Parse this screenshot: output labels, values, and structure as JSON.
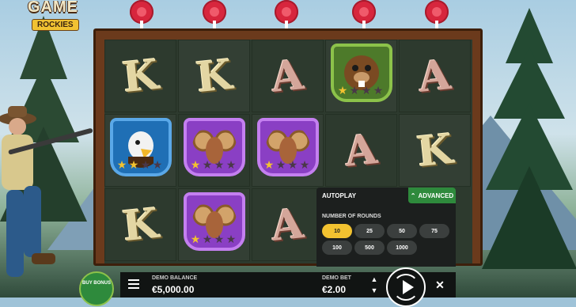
{
  "game": {
    "logo_title": "GAME",
    "logo_subtitle": "ROCKIES"
  },
  "reels": [
    [
      "K",
      "K",
      "A",
      "beaver",
      "A"
    ],
    [
      "eagle",
      "ram",
      "ram",
      "A",
      "K"
    ],
    [
      "K",
      "ram",
      "A",
      "",
      ""
    ]
  ],
  "symbols": {
    "beaver": {
      "stars": 1,
      "max_stars": 4
    },
    "eagle": {
      "stars": 2,
      "max_stars": 4
    },
    "ram_r2c2": {
      "stars": 1,
      "max_stars": 4
    },
    "ram_r2c3": {
      "stars": 1,
      "max_stars": 4
    },
    "ram_r3c2": {
      "stars": 1,
      "max_stars": 4
    }
  },
  "autoplay": {
    "title": "AUTOPLAY",
    "advanced_label": "ADVANCED",
    "rounds_label": "NUMBER OF ROUNDS",
    "options": [
      "10",
      "25",
      "50",
      "75",
      "100",
      "500",
      "1000"
    ],
    "selected": "10"
  },
  "footer": {
    "buy_bonus_label": "BUY BONUS",
    "balance_label": "DEMO BALANCE",
    "balance_value": "€5,000.00",
    "bet_label": "DEMO BET",
    "bet_value": "€2.00"
  },
  "colors": {
    "accent_green": "#2e8a3c",
    "selected_chip": "#f2c230",
    "target_red": "#d7263d"
  }
}
